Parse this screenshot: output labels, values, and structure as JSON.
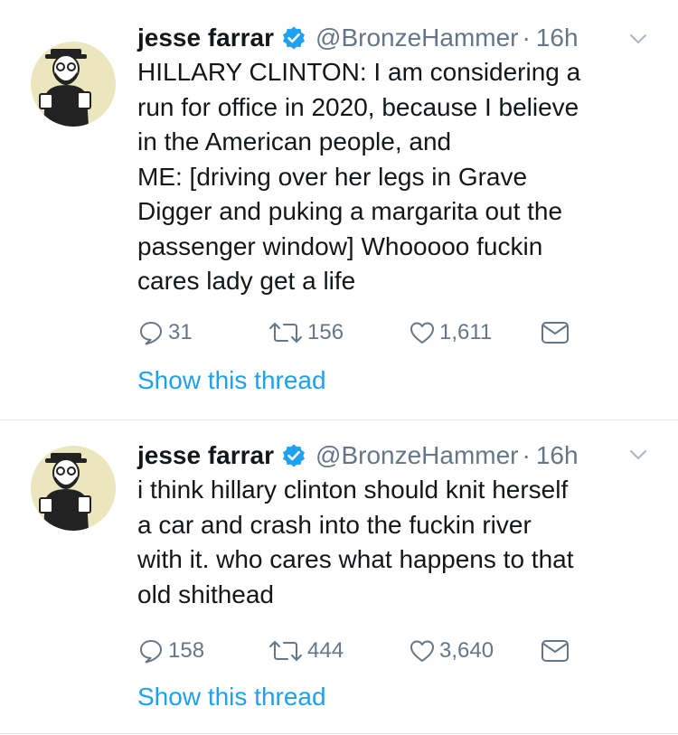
{
  "tweets": [
    {
      "name": "jesse farrar",
      "handle": "@BronzeHammer",
      "separator": "·",
      "time": "16h",
      "lines": [
        "HILLARY CLINTON: I am considering a",
        "run for office in 2020, because I believe",
        "in the American people, and",
        "ME: [driving over her legs in Grave",
        "Digger and puking a margarita out the",
        "passenger window] Whooooo fuckin",
        "cares lady get a life"
      ],
      "replies": "31",
      "retweets": "156",
      "likes": "1,611",
      "show_thread": "Show this thread"
    },
    {
      "name": "jesse farrar",
      "handle": "@BronzeHammer",
      "separator": "·",
      "time": "16h",
      "lines": [
        "i think hillary clinton should knit herself",
        "a car and crash into the fuckin river",
        "with it. who cares what happens to that",
        "old shithead"
      ],
      "replies": "158",
      "retweets": "444",
      "likes": "3,640",
      "show_thread": "Show this thread"
    }
  ],
  "colors": {
    "text": "#14171a",
    "muted": "#657786",
    "link": "#1da1f2",
    "verified": "#1da1f2",
    "divider": "#e1e8ed",
    "avatar_bg": "#ece6bf"
  },
  "icons": [
    "verified-badge-icon",
    "chevron-down-icon",
    "reply-icon",
    "retweet-icon",
    "like-icon",
    "dm-icon"
  ]
}
